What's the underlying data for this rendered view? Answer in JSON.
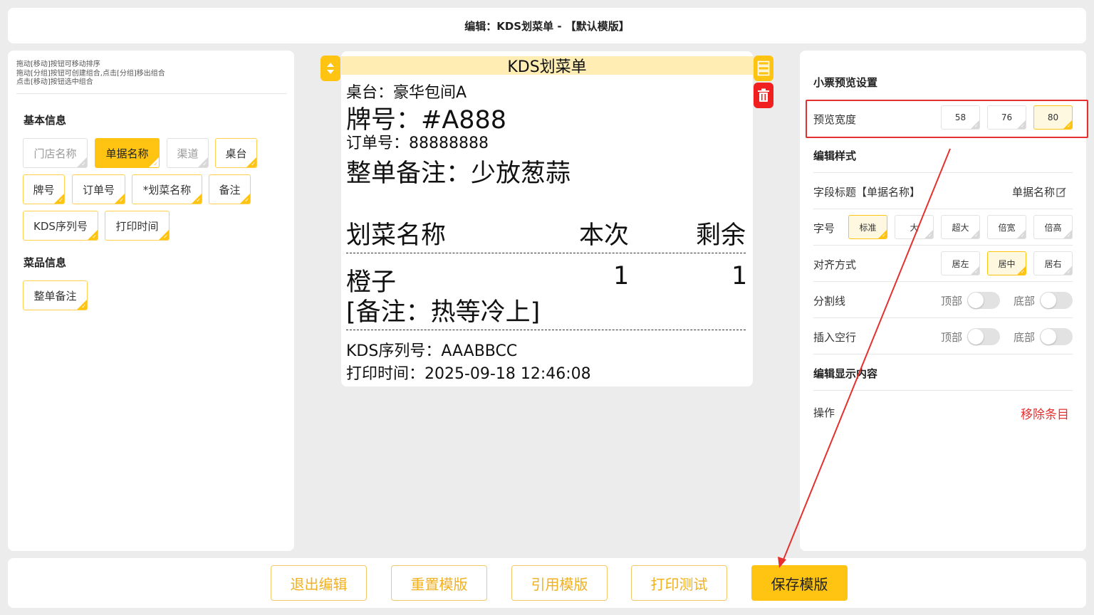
{
  "header": {
    "title": "编辑：KDS划菜单 - 【默认模版】"
  },
  "left_panel": {
    "hints": [
      "拖动[移动]按钮可移动排序",
      "拖动[分组]按钮可创建组合,点击[分组]移出组合",
      "点击[移动]按钮选中组合"
    ],
    "basic_title": "基本信息",
    "basic_items": [
      {
        "label": "门店名称",
        "state": "inactive"
      },
      {
        "label": "单据名称",
        "state": "active"
      },
      {
        "label": "渠道",
        "state": "inactive"
      },
      {
        "label": "桌台",
        "state": "normal"
      },
      {
        "label": "牌号",
        "state": "normal"
      },
      {
        "label": "订单号",
        "state": "normal"
      },
      {
        "label": "*划菜名称",
        "state": "normal"
      },
      {
        "label": "备注",
        "state": "normal"
      },
      {
        "label": "KDS序列号",
        "state": "normal"
      },
      {
        "label": "打印时间",
        "state": "normal"
      }
    ],
    "dish_title": "菜品信息",
    "dish_items": [
      {
        "label": "整单备注",
        "state": "normal"
      }
    ]
  },
  "receipt": {
    "title": "KDS划菜单",
    "table": "桌台：豪华包间A",
    "plate": "牌号：#A888",
    "order_no": "订单号：88888888",
    "whole_note": "整单备注：少放葱蒜",
    "col_name": "划菜名称",
    "col_this": "本次",
    "col_remain": "剩余",
    "item_name": "橙子",
    "item_this": "1",
    "item_remain": "1",
    "item_note": "[备注：热等冷上]",
    "kds_serial": "KDS序列号：AAABBCC",
    "print_time": "打印时间：2025-09-18 12:46:08"
  },
  "right_panel": {
    "preview_title": "小票预览设置",
    "width_label": "预览宽度",
    "width_options": [
      "58",
      "76",
      "80"
    ],
    "width_selected": "80",
    "style_title": "编辑样式",
    "field_title_label": "字段标题【单据名称】",
    "field_title_value": "单据名称",
    "font_label": "字号",
    "font_options": [
      "标准",
      "大",
      "超大",
      "倍宽",
      "倍高"
    ],
    "font_selected": "标准",
    "align_label": "对齐方式",
    "align_options": [
      "居左",
      "居中",
      "居右"
    ],
    "align_selected": "居中",
    "divider_label": "分割线",
    "blank_label": "插入空行",
    "top_label": "顶部",
    "bottom_label": "底部",
    "content_title": "编辑显示内容",
    "action_label": "操作",
    "remove_label": "移除条目"
  },
  "footer": {
    "buttons": [
      "退出编辑",
      "重置模版",
      "引用模版",
      "打印测试",
      "保存模版"
    ]
  },
  "colors": {
    "accent": "#ffc312",
    "highlight": "#e53030",
    "danger": "#f02020"
  },
  "icons": [
    "sort-arrows-icon",
    "group-icon",
    "trash-icon",
    "edit-icon",
    "check-corner-icon"
  ]
}
